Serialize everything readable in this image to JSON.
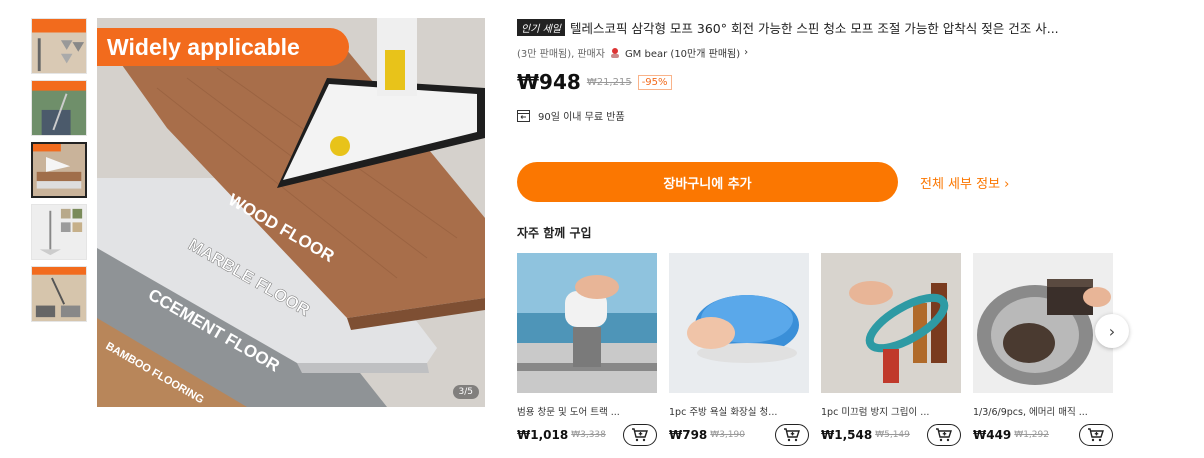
{
  "gallery": {
    "banner_text": "Widely applicable",
    "counter": "3/5",
    "floor_labels": [
      "WOOD FLOOR",
      "MARBLE FLOOR",
      "CCEMENT FLOOR",
      "BAMBOO FLOORING"
    ]
  },
  "product": {
    "sale_tag": "인기 세일",
    "title": "텔레스코픽 삼각형 모프 360° 회전 가능한 스핀 청소 모프 조절 가능한 압착식 젖은 건조 사...",
    "sold_count": "(3만 판매됨),",
    "seller_label": "판매자",
    "seller_name": "GM bear (10만개 판매됨)",
    "price": "₩948",
    "original_price": "₩21,215",
    "discount": "-95%",
    "return_policy": "90일 이내 무료 반품"
  },
  "actions": {
    "add_to_cart": "장바구니에 추가",
    "full_details": "전체 세부 정보 ›"
  },
  "frequently_bought": {
    "title": "자주 함께 구입",
    "items": [
      {
        "name": "범용 창문 및 도어 트랙 ...",
        "price": "₩1,018",
        "original": "₩3,338"
      },
      {
        "name": "1pc 주방 욕실 화장실 청...",
        "price": "₩798",
        "original": "₩3,190"
      },
      {
        "name": "1pc 미끄럼 방지 그립이 ...",
        "price": "₩1,548",
        "original": "₩5,149"
      },
      {
        "name": "1/3/6/9pcs, 에머리 매직 ...",
        "price": "₩449",
        "original": "₩1,292"
      }
    ]
  },
  "colors": {
    "accent": "#fb7701"
  },
  "icons": [
    "return-box-icon",
    "chevron-right-icon",
    "cart-plus-icon",
    "seller-icon"
  ]
}
